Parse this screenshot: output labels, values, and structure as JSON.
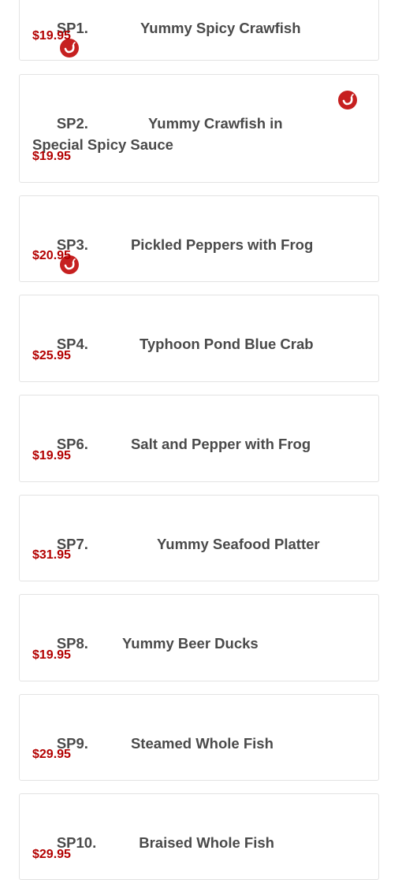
{
  "menu_items": [
    {
      "code": "SP1.",
      "name": "Yummy Spicy Crawfish",
      "price": "$19.95",
      "spicy": true
    },
    {
      "code": "SP2.",
      "name": "Yummy Crawfish in Special Spicy Sauce",
      "price": "$19.95",
      "spicy": true
    },
    {
      "code": "SP3.",
      "name": "Pickled Peppers with Frog",
      "price": "$20.95",
      "spicy": true
    },
    {
      "code": "SP4.",
      "name": "Typhoon Pond Blue Crab",
      "price": "$25.95",
      "spicy": false
    },
    {
      "code": "SP6.",
      "name": "Salt and Pepper with Frog",
      "price": "$19.95",
      "spicy": false
    },
    {
      "code": "SP7.",
      "name": "Yummy Seafood Platter",
      "price": "$31.95",
      "spicy": false
    },
    {
      "code": "SP8.",
      "name": "Yummy Beer Ducks",
      "price": "$19.95",
      "spicy": false
    },
    {
      "code": "SP9.",
      "name": "Steamed Whole Fish",
      "price": "$29.95",
      "spicy": false
    },
    {
      "code": "SP10.",
      "name": "Braised Whole Fish",
      "price": "$29.95",
      "spicy": false
    }
  ],
  "colors": {
    "price": "#b30000",
    "title": "#4a4a4a",
    "spicy_icon": "#c62020",
    "border": "#e3e3e3"
  },
  "icons": {
    "spicy": "chili-pepper-icon"
  }
}
